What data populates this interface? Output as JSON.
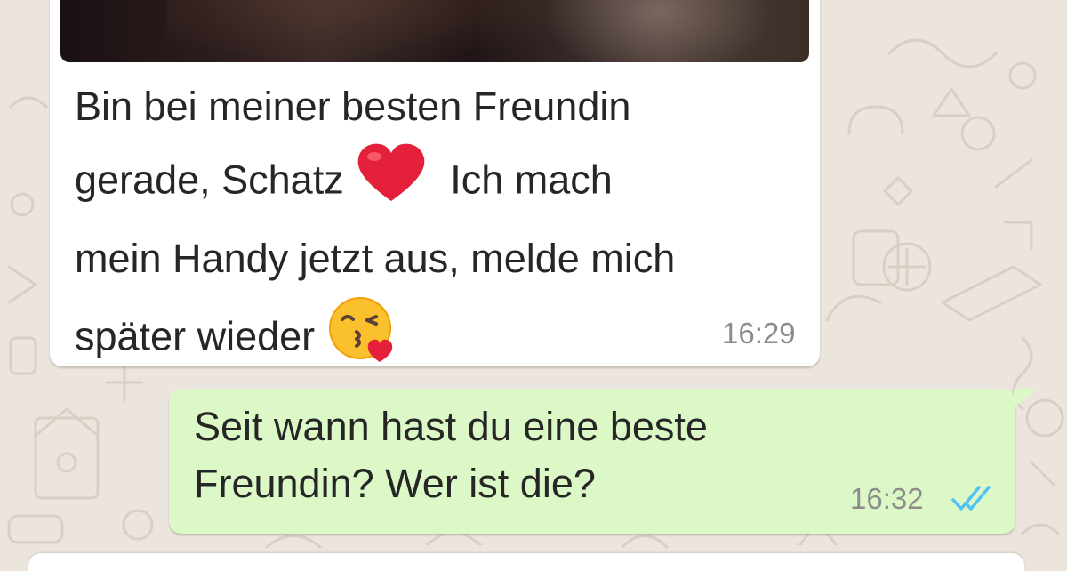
{
  "chat": {
    "incoming": {
      "lines": [
        "Bin bei meiner besten Freundin",
        "gerade, Schatz",
        "Ich mach",
        "mein Handy jetzt aus, melde mich",
        "später wieder"
      ],
      "emojis": [
        "red-heart",
        "face-blowing-a-kiss"
      ],
      "time": "16:29"
    },
    "outgoing": {
      "lines": [
        "Seit wann hast du eine beste",
        "Freundin? Wer ist die?"
      ],
      "time": "16:32",
      "status": "read-double-check"
    }
  },
  "colors": {
    "wallpaper": "#ece5dd",
    "incoming_bubble": "#ffffff",
    "outgoing_bubble": "#dcf8c6",
    "read_ticks": "#4fc3f7",
    "timestamp": "#8c8c8c",
    "text": "#262626"
  }
}
